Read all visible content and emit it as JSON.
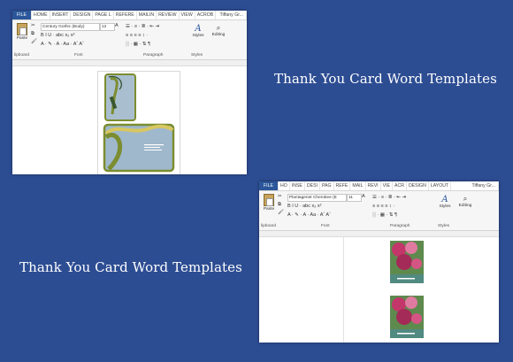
{
  "captions": {
    "top_right": "Thank You Card Word Templates",
    "bottom_left": "Thank You Card Word Templates"
  },
  "window1": {
    "tabs": [
      "FILE",
      "HOME",
      "INSERT",
      "DESIGN",
      "PAGE L",
      "REFERE",
      "MAILIN",
      "REVIEW",
      "VIEW",
      "ACROB"
    ],
    "user": "Tiffany Gr...",
    "font_name": "Century Gothic (Body)",
    "font_size": "12",
    "paste_label": "Paste",
    "styles_label": "Styles",
    "editing_label": "Editing",
    "groups": {
      "clipboard": "lipboard",
      "font": "Font",
      "paragraph": "Paragraph",
      "styles": "Styles"
    },
    "format_row": "B  I  U  · abc  x₂  x²",
    "color_row": "A ·  ✎ ·  A ·  Aa ·  Aˆ  Aˇ",
    "para_row1": "☰ ·  ≡ ·  ≣ ·  ⇤  ⇥",
    "para_row2": "≡  ≡  ≡  ≡  ↕ ·",
    "para_row3": "░ ·  ▦ ·  ⇅  ¶"
  },
  "window2": {
    "tabs": [
      "FILE",
      "HO",
      "INSE",
      "DESI",
      "PAG",
      "REFE",
      "MAIL",
      "REVI",
      "VIE",
      "ACR",
      "DESIGN",
      "LAYOUT"
    ],
    "user": "Tiffany Gr...",
    "font_name": "Plantagenet Cherokee (E",
    "font_size": "11",
    "paste_label": "Paste",
    "styles_label": "Styles",
    "editing_label": "Editing",
    "groups": {
      "clipboard": "lipboard",
      "font": "Font",
      "paragraph": "Paragraph",
      "styles": "Styles"
    },
    "format_row": "B  I  U  · abc  x₂  x²",
    "color_row": "A ·  ✎ ·  A ·  Aa ·  Aˆ  Aˇ",
    "para_row1": "☰ ·  ≡ ·  ≣ ·  ⇤  ⇥",
    "para_row2": "≡  ≡  ≡  ≡  ↕ ·",
    "para_row3": "░ ·  ▦ ·  ⇅  ¶"
  },
  "colors": {
    "background": "#2d4d93",
    "file_tab": "#2b579a",
    "card_green": "#7c8d2f",
    "card_blue": "#9fb8cc",
    "photo_pink": "#c2366a",
    "photo_green": "#5e8a4e"
  }
}
